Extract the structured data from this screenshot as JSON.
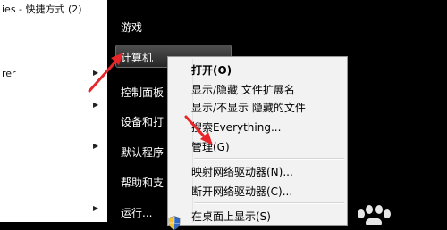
{
  "left_menu": {
    "items": [
      {
        "label": "ies - 快捷方式 (2)",
        "has_arrow": false
      },
      {
        "label": "rer",
        "has_arrow": true
      },
      {
        "label": "",
        "has_arrow": true
      },
      {
        "label": "",
        "has_arrow": true
      },
      {
        "label": "",
        "has_arrow": true
      }
    ]
  },
  "start_menu_right": {
    "items": [
      {
        "label": "游戏"
      },
      {
        "label": "计算机",
        "highlighted": true
      },
      {
        "label": "控制面板"
      },
      {
        "label": "设备和打"
      },
      {
        "label": "默认程序"
      },
      {
        "label": "帮助和支"
      },
      {
        "label": "运行..."
      }
    ]
  },
  "context_menu": {
    "items": [
      {
        "label": "打开(O)",
        "bold": true
      },
      {
        "label": "显示/隐藏 文件扩展名"
      },
      {
        "label": "显示/不显示 隐藏的文件"
      },
      {
        "label": "搜索Everything..."
      },
      {
        "label": "管理(G)",
        "icon": "uac-shield-icon"
      },
      {
        "label": "映射网络驱动器(N)..."
      },
      {
        "label": "断开网络驱动器(C)..."
      },
      {
        "label": "在桌面上显示(S)"
      }
    ]
  },
  "annotations": {
    "arrow_color": "#e8262a",
    "icons": [
      "uac-shield-icon",
      "red-arrow-icon",
      "chevron-right-icon",
      "paw-watermark-icon"
    ]
  }
}
